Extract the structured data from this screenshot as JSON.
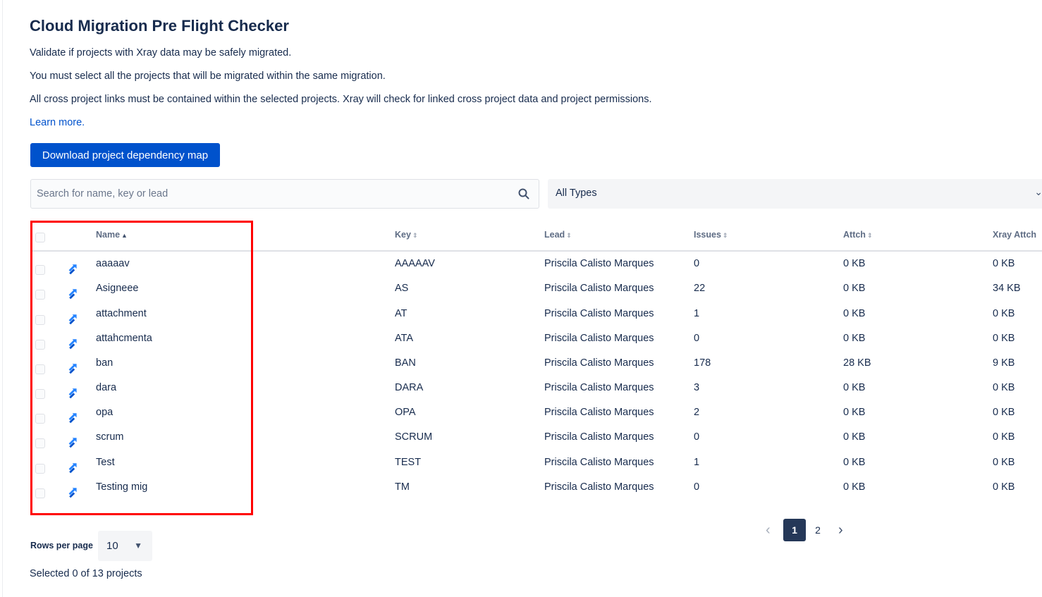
{
  "header": {
    "title": "Cloud Migration Pre Flight Checker",
    "desc1": "Validate if projects with Xray data may be safely migrated.",
    "desc2": "You must select all the projects that will be migrated within the same migration.",
    "desc3": "All cross project links must be contained within the selected projects. Xray will check for linked cross project data and project permissions.",
    "learn_more": "Learn more."
  },
  "toolbar": {
    "download_label": "Download project dependency map",
    "search_placeholder": "Search for name, key or lead",
    "type_filter": "All Types"
  },
  "table": {
    "columns": {
      "name": "Name",
      "key": "Key",
      "lead": "Lead",
      "issues": "Issues",
      "attch": "Attch",
      "xray_attch": "Xray Attch"
    },
    "rows": [
      {
        "name": "aaaaav",
        "key": "AAAAAV",
        "lead": "Priscila Calisto Marques",
        "issues": "0",
        "attch": "0 KB",
        "xray_attch": "0 KB"
      },
      {
        "name": "Asigneee",
        "key": "AS",
        "lead": "Priscila Calisto Marques",
        "issues": "22",
        "attch": "0 KB",
        "xray_attch": "34 KB"
      },
      {
        "name": "attachment",
        "key": "AT",
        "lead": "Priscila Calisto Marques",
        "issues": "1",
        "attch": "0 KB",
        "xray_attch": "0 KB"
      },
      {
        "name": "attahcmenta",
        "key": "ATA",
        "lead": "Priscila Calisto Marques",
        "issues": "0",
        "attch": "0 KB",
        "xray_attch": "0 KB"
      },
      {
        "name": "ban",
        "key": "BAN",
        "lead": "Priscila Calisto Marques",
        "issues": "178",
        "attch": "28 KB",
        "xray_attch": "9 KB"
      },
      {
        "name": "dara",
        "key": "DARA",
        "lead": "Priscila Calisto Marques",
        "issues": "3",
        "attch": "0 KB",
        "xray_attch": "0 KB"
      },
      {
        "name": "opa",
        "key": "OPA",
        "lead": "Priscila Calisto Marques",
        "issues": "2",
        "attch": "0 KB",
        "xray_attch": "0 KB"
      },
      {
        "name": "scrum",
        "key": "SCRUM",
        "lead": "Priscila Calisto Marques",
        "issues": "0",
        "attch": "0 KB",
        "xray_attch": "0 KB"
      },
      {
        "name": "Test",
        "key": "TEST",
        "lead": "Priscila Calisto Marques",
        "issues": "1",
        "attch": "0 KB",
        "xray_attch": "0 KB"
      },
      {
        "name": "Testing mig",
        "key": "TM",
        "lead": "Priscila Calisto Marques",
        "issues": "0",
        "attch": "0 KB",
        "xray_attch": "0 KB"
      }
    ]
  },
  "footer": {
    "rows_per_page_label": "Rows per page",
    "rows_per_page_value": "10",
    "selected_text": "Selected 0 of 13 projects",
    "pages": [
      "1",
      "2"
    ],
    "current_page": "1"
  },
  "icons": {
    "project": "jira-software-project-icon",
    "search": "search-icon",
    "chevron": "chevron-down-icon"
  },
  "colors": {
    "primary": "#0052cc",
    "text": "#172b4d",
    "highlight": "#ff0000",
    "current_page": "#253858"
  }
}
